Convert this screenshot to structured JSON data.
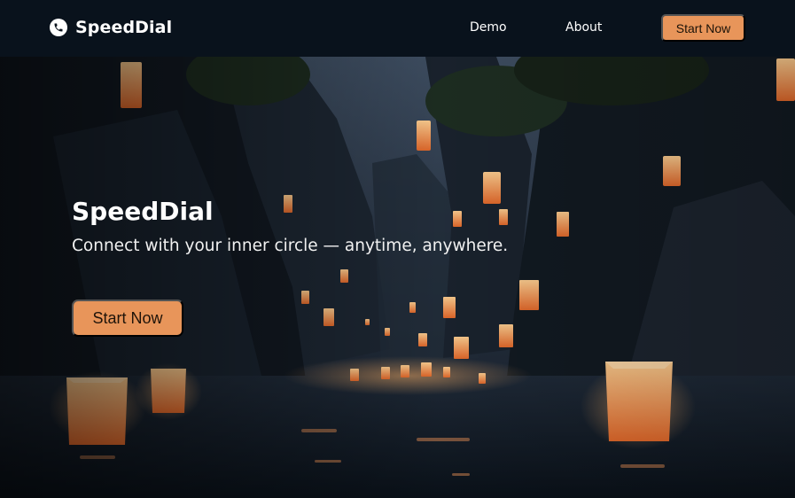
{
  "nav": {
    "brand_icon": "phone-icon",
    "brand_name": "SpeedDial",
    "links": [
      "Demo",
      "About"
    ],
    "cta": "Start Now"
  },
  "hero": {
    "title": "SpeedDial",
    "subtitle": "Connect with your inner circle — anytime, anywhere.",
    "cta": "Start Now"
  },
  "colors": {
    "nav_bg": "#09121c",
    "accent": "#e8955a"
  }
}
